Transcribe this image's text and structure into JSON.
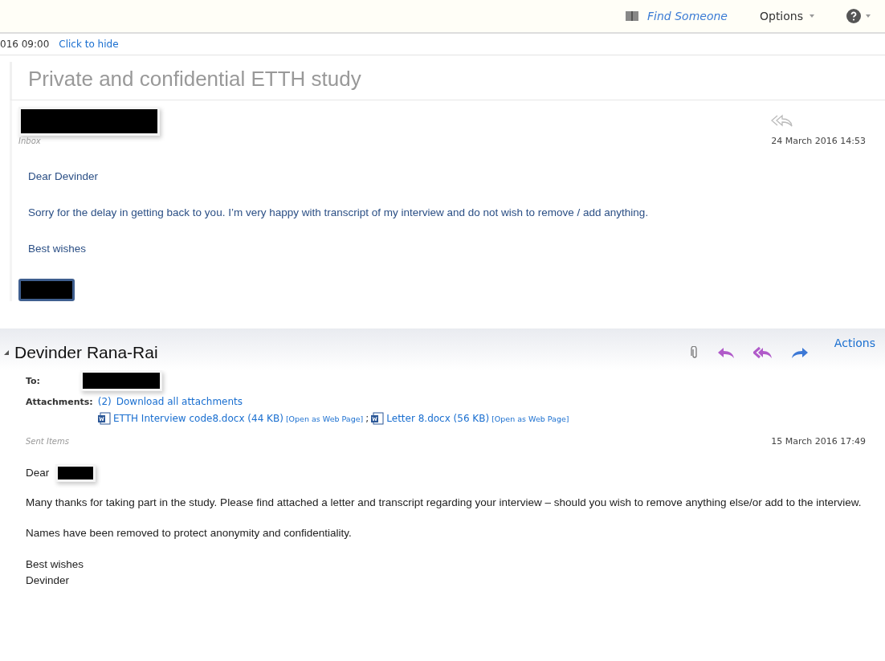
{
  "top_bar": {
    "find_someone": "Find Someone",
    "options": "Options"
  },
  "notice": {
    "time": "016 09:00",
    "hide_link": "Click to hide"
  },
  "subject": "Private and confidential ETTH study",
  "messages": [
    {
      "kind": "received",
      "folder": "Inbox",
      "date": "24 March 2016 14:53",
      "body": [
        "Dear Devinder",
        "Sorry for the delay in getting back to you.  I’m very happy with transcript of my interview and do not wish to remove / add anything.",
        "Best wishes"
      ]
    },
    {
      "kind": "sent",
      "sender": "Devinder Rana-Rai",
      "actions": "Actions",
      "to_label": "To:",
      "attachments_label": "Attachments:",
      "attachment_count": "(2)",
      "download_all": "Download all attachments",
      "attachments": [
        {
          "name": "ETTH Interview code8.docx (44 KB)",
          "open": "[Open as Web Page]",
          "separator": ";"
        },
        {
          "name": "Letter 8.docx (56 KB)",
          "open": "[Open as Web Page]"
        }
      ],
      "folder": "Sent Items",
      "date": "15 March 2016 17:49",
      "greeting": "Dear",
      "body": [
        "Many thanks for taking part in the study. Please find attached a letter and transcript regarding your interview – should you wish to remove anything else/or add to the interview.",
        "Names have been removed to protect anonymity and confidentiality."
      ],
      "signoff": [
        "Best wishes",
        "Devinder"
      ]
    }
  ]
}
